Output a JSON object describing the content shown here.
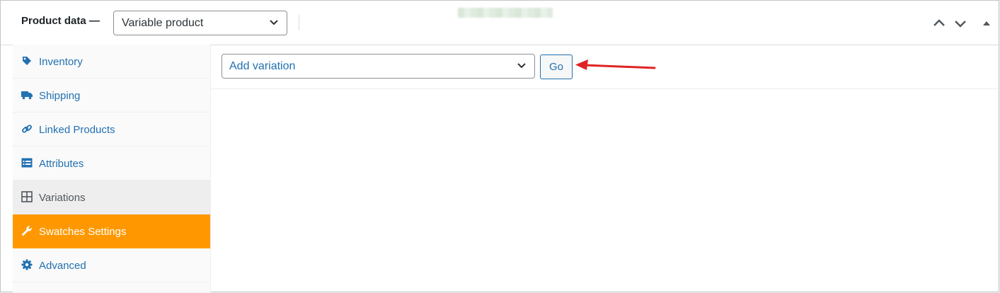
{
  "header": {
    "title": "Product data —",
    "product_type": "Variable product",
    "controls": [
      "move-up-icon",
      "move-down-icon",
      "toggle-panel-icon"
    ]
  },
  "sidebar": {
    "items": [
      {
        "label": "Inventory",
        "icon": "tag-icon"
      },
      {
        "label": "Shipping",
        "icon": "truck-icon"
      },
      {
        "label": "Linked Products",
        "icon": "link-icon"
      },
      {
        "label": "Attributes",
        "icon": "list-icon"
      },
      {
        "label": "Variations",
        "icon": "grid-icon"
      },
      {
        "label": "Swatches Settings",
        "icon": "wrench-icon"
      },
      {
        "label": "Advanced",
        "icon": "gear-icon"
      }
    ],
    "active": "Swatches Settings"
  },
  "main": {
    "variation_select": "Add variation",
    "go_label": "Go"
  },
  "colors": {
    "accent": "#ff9800",
    "link": "#2271b1",
    "annotation_arrow": "#e02424"
  }
}
